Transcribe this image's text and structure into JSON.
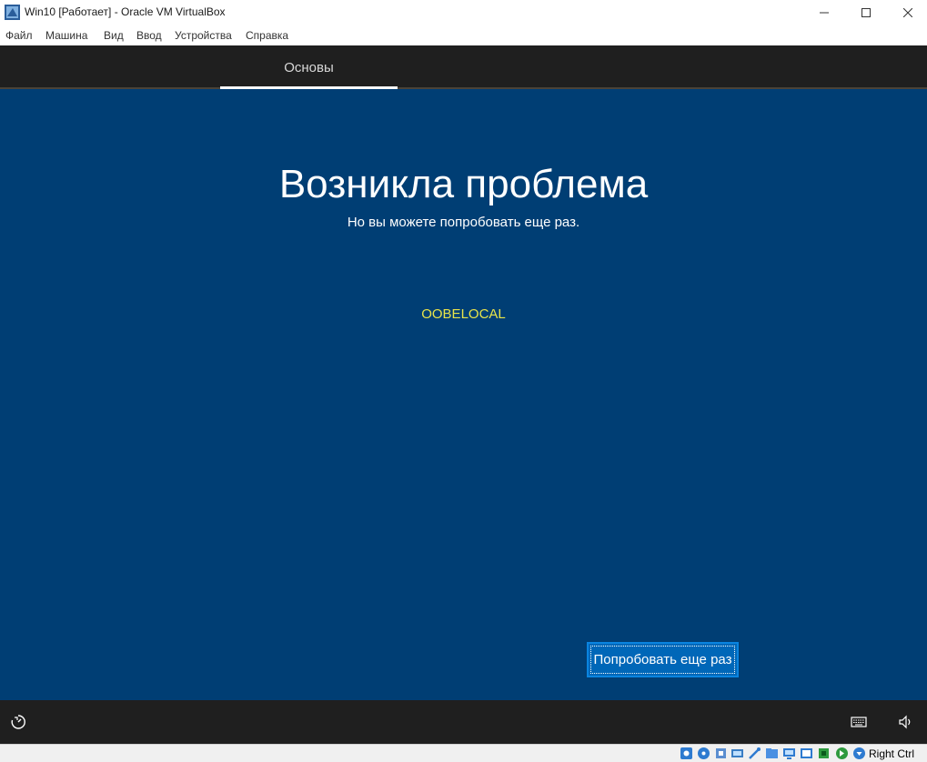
{
  "window": {
    "title": "Win10 [Работает] - Oracle VM VirtualBox"
  },
  "menu": {
    "items": [
      "Файл",
      "Машина",
      "Вид",
      "Ввод",
      "Устройства",
      "Справка"
    ]
  },
  "guest": {
    "nav_tab": "Основы",
    "headline": "Возникла проблема",
    "subline": "Но вы можете попробовать еще раз.",
    "code": "OOBELOCAL",
    "retry_label": "Попробовать еще раз"
  },
  "statusbar": {
    "host_key": "Right Ctrl",
    "icons": [
      "hard-disk-icon",
      "optical-disk-icon",
      "audio-icon",
      "network-icon",
      "usb-icon",
      "shared-folders-icon",
      "display-icon",
      "video-capture-icon",
      "cpu-icon",
      "mouse-integration-icon",
      "keyboard-capture-icon"
    ]
  },
  "colors": {
    "guest_bg": "#003e74",
    "accent": "#0067b8",
    "code": "#e8e44a"
  }
}
